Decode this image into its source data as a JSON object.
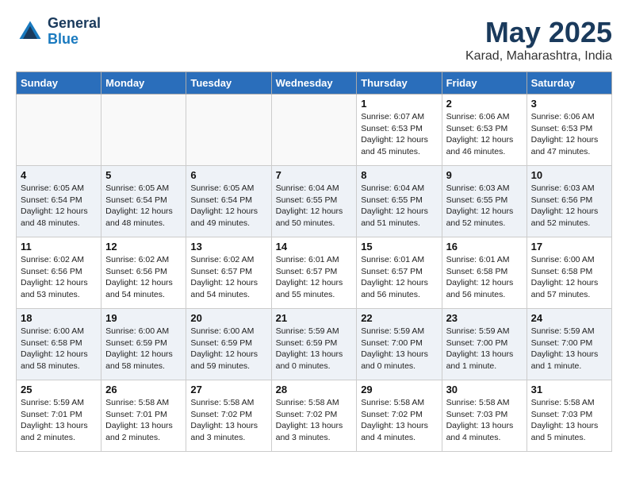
{
  "logo": {
    "line1": "General",
    "line2": "Blue"
  },
  "title": "May 2025",
  "location": "Karad, Maharashtra, India",
  "weekdays": [
    "Sunday",
    "Monday",
    "Tuesday",
    "Wednesday",
    "Thursday",
    "Friday",
    "Saturday"
  ],
  "weeks": [
    [
      {
        "day": "",
        "info": ""
      },
      {
        "day": "",
        "info": ""
      },
      {
        "day": "",
        "info": ""
      },
      {
        "day": "",
        "info": ""
      },
      {
        "day": "1",
        "info": "Sunrise: 6:07 AM\nSunset: 6:53 PM\nDaylight: 12 hours\nand 45 minutes."
      },
      {
        "day": "2",
        "info": "Sunrise: 6:06 AM\nSunset: 6:53 PM\nDaylight: 12 hours\nand 46 minutes."
      },
      {
        "day": "3",
        "info": "Sunrise: 6:06 AM\nSunset: 6:53 PM\nDaylight: 12 hours\nand 47 minutes."
      }
    ],
    [
      {
        "day": "4",
        "info": "Sunrise: 6:05 AM\nSunset: 6:54 PM\nDaylight: 12 hours\nand 48 minutes."
      },
      {
        "day": "5",
        "info": "Sunrise: 6:05 AM\nSunset: 6:54 PM\nDaylight: 12 hours\nand 48 minutes."
      },
      {
        "day": "6",
        "info": "Sunrise: 6:05 AM\nSunset: 6:54 PM\nDaylight: 12 hours\nand 49 minutes."
      },
      {
        "day": "7",
        "info": "Sunrise: 6:04 AM\nSunset: 6:55 PM\nDaylight: 12 hours\nand 50 minutes."
      },
      {
        "day": "8",
        "info": "Sunrise: 6:04 AM\nSunset: 6:55 PM\nDaylight: 12 hours\nand 51 minutes."
      },
      {
        "day": "9",
        "info": "Sunrise: 6:03 AM\nSunset: 6:55 PM\nDaylight: 12 hours\nand 52 minutes."
      },
      {
        "day": "10",
        "info": "Sunrise: 6:03 AM\nSunset: 6:56 PM\nDaylight: 12 hours\nand 52 minutes."
      }
    ],
    [
      {
        "day": "11",
        "info": "Sunrise: 6:02 AM\nSunset: 6:56 PM\nDaylight: 12 hours\nand 53 minutes."
      },
      {
        "day": "12",
        "info": "Sunrise: 6:02 AM\nSunset: 6:56 PM\nDaylight: 12 hours\nand 54 minutes."
      },
      {
        "day": "13",
        "info": "Sunrise: 6:02 AM\nSunset: 6:57 PM\nDaylight: 12 hours\nand 54 minutes."
      },
      {
        "day": "14",
        "info": "Sunrise: 6:01 AM\nSunset: 6:57 PM\nDaylight: 12 hours\nand 55 minutes."
      },
      {
        "day": "15",
        "info": "Sunrise: 6:01 AM\nSunset: 6:57 PM\nDaylight: 12 hours\nand 56 minutes."
      },
      {
        "day": "16",
        "info": "Sunrise: 6:01 AM\nSunset: 6:58 PM\nDaylight: 12 hours\nand 56 minutes."
      },
      {
        "day": "17",
        "info": "Sunrise: 6:00 AM\nSunset: 6:58 PM\nDaylight: 12 hours\nand 57 minutes."
      }
    ],
    [
      {
        "day": "18",
        "info": "Sunrise: 6:00 AM\nSunset: 6:58 PM\nDaylight: 12 hours\nand 58 minutes."
      },
      {
        "day": "19",
        "info": "Sunrise: 6:00 AM\nSunset: 6:59 PM\nDaylight: 12 hours\nand 58 minutes."
      },
      {
        "day": "20",
        "info": "Sunrise: 6:00 AM\nSunset: 6:59 PM\nDaylight: 12 hours\nand 59 minutes."
      },
      {
        "day": "21",
        "info": "Sunrise: 5:59 AM\nSunset: 6:59 PM\nDaylight: 13 hours\nand 0 minutes."
      },
      {
        "day": "22",
        "info": "Sunrise: 5:59 AM\nSunset: 7:00 PM\nDaylight: 13 hours\nand 0 minutes."
      },
      {
        "day": "23",
        "info": "Sunrise: 5:59 AM\nSunset: 7:00 PM\nDaylight: 13 hours\nand 1 minute."
      },
      {
        "day": "24",
        "info": "Sunrise: 5:59 AM\nSunset: 7:00 PM\nDaylight: 13 hours\nand 1 minute."
      }
    ],
    [
      {
        "day": "25",
        "info": "Sunrise: 5:59 AM\nSunset: 7:01 PM\nDaylight: 13 hours\nand 2 minutes."
      },
      {
        "day": "26",
        "info": "Sunrise: 5:58 AM\nSunset: 7:01 PM\nDaylight: 13 hours\nand 2 minutes."
      },
      {
        "day": "27",
        "info": "Sunrise: 5:58 AM\nSunset: 7:02 PM\nDaylight: 13 hours\nand 3 minutes."
      },
      {
        "day": "28",
        "info": "Sunrise: 5:58 AM\nSunset: 7:02 PM\nDaylight: 13 hours\nand 3 minutes."
      },
      {
        "day": "29",
        "info": "Sunrise: 5:58 AM\nSunset: 7:02 PM\nDaylight: 13 hours\nand 4 minutes."
      },
      {
        "day": "30",
        "info": "Sunrise: 5:58 AM\nSunset: 7:03 PM\nDaylight: 13 hours\nand 4 minutes."
      },
      {
        "day": "31",
        "info": "Sunrise: 5:58 AM\nSunset: 7:03 PM\nDaylight: 13 hours\nand 5 minutes."
      }
    ]
  ]
}
